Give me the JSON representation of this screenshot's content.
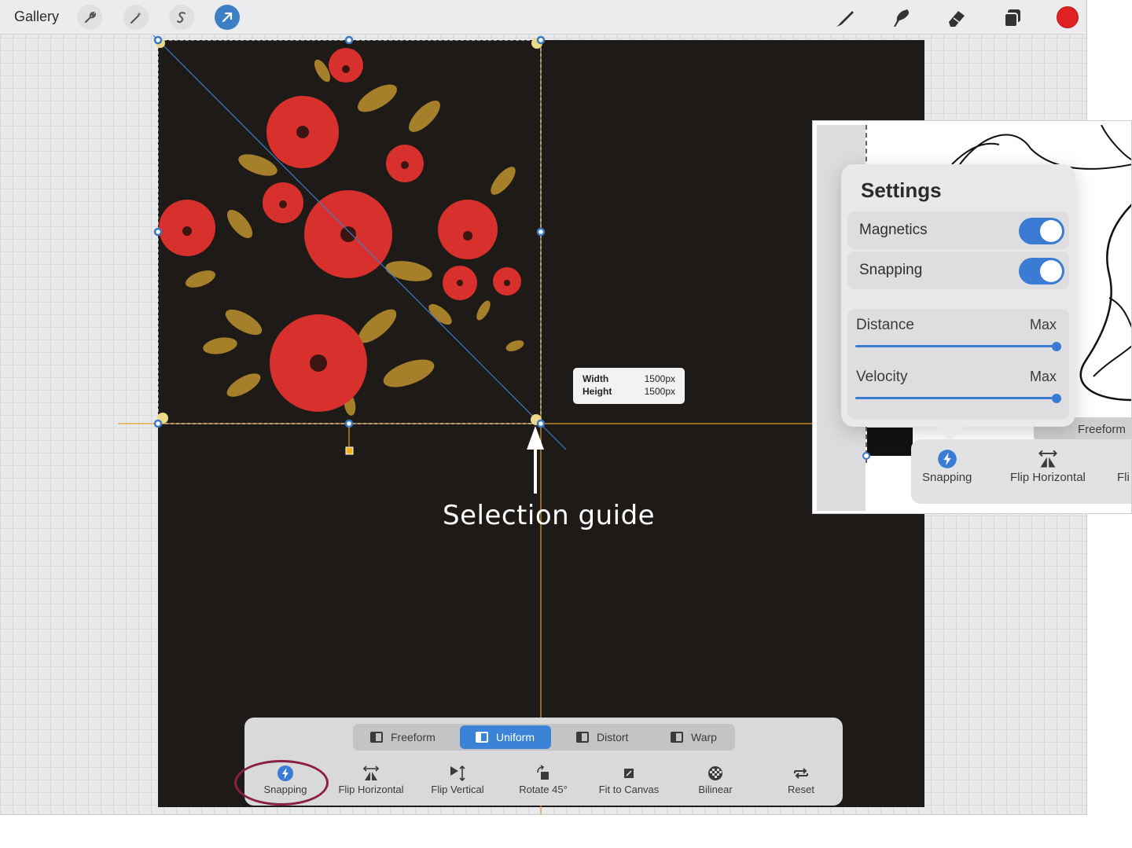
{
  "topbar": {
    "gallery_label": "Gallery",
    "left_tools": [
      "wrench-icon",
      "magic-wand-icon",
      "selection-s-icon",
      "arrow-transform-icon"
    ],
    "right_tools": [
      "brush-icon",
      "smudge-icon",
      "eraser-icon",
      "layers-icon"
    ],
    "active_color": "#e02121",
    "accent": "#3c7fc4"
  },
  "canvas": {
    "background": "#1e1a17",
    "size_tooltip": {
      "width_label": "Width",
      "width_value": "1500px",
      "height_label": "Height",
      "height_value": "1500px"
    },
    "callout": "Selection guide"
  },
  "transform_bar": {
    "modes": [
      {
        "label": "Freeform",
        "active": false
      },
      {
        "label": "Uniform",
        "active": true
      },
      {
        "label": "Distort",
        "active": false
      },
      {
        "label": "Warp",
        "active": false
      }
    ],
    "tools": [
      {
        "label": "Snapping",
        "icon": "lightning-icon"
      },
      {
        "label": "Flip Horizontal",
        "icon": "flip-horizontal-icon"
      },
      {
        "label": "Flip Vertical",
        "icon": "flip-vertical-icon"
      },
      {
        "label": "Rotate 45°",
        "icon": "rotate-icon"
      },
      {
        "label": "Fit to Canvas",
        "icon": "fit-canvas-icon"
      },
      {
        "label": "Bilinear",
        "icon": "bilinear-icon"
      },
      {
        "label": "Reset",
        "icon": "reset-icon"
      }
    ]
  },
  "inset": {
    "settings_title": "Settings",
    "magnetics_label": "Magnetics",
    "magnetics_on": true,
    "snapping_label": "Snapping",
    "snapping_on": true,
    "distance_label": "Distance",
    "distance_value": "Max",
    "distance_level": 1.0,
    "velocity_label": "Velocity",
    "velocity_value": "Max",
    "velocity_level": 1.0,
    "mode_label": "Freeform",
    "tools": [
      {
        "label": "Snapping",
        "icon": "lightning-icon"
      },
      {
        "label": "Flip Horizontal",
        "icon": "flip-horizontal-icon"
      },
      {
        "label": "Fli",
        "icon": "flip-vertical-icon"
      }
    ]
  }
}
